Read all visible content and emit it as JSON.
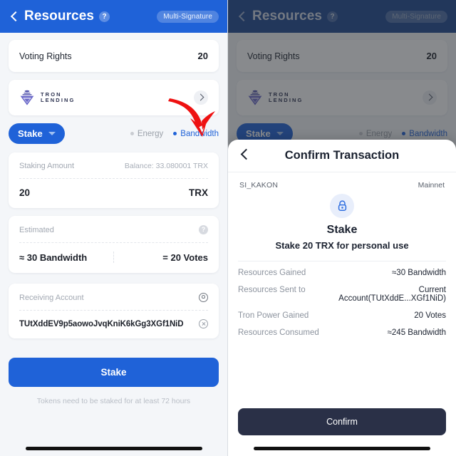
{
  "header": {
    "back_icon": "chevron-left-icon",
    "title": "Resources",
    "help_label": "?",
    "multisig_badge": "Multi-Signature"
  },
  "voting": {
    "label": "Voting Rights",
    "value": "20"
  },
  "lending": {
    "logo_line1": "TRON",
    "logo_line2": "LENDING",
    "chevron_icon": "chevron-right-icon"
  },
  "selector": {
    "stake_label": "Stake",
    "caret_icon": "caret-down-icon",
    "options": [
      {
        "label": "Energy",
        "active": false
      },
      {
        "label": "Bandwidth",
        "active": true
      }
    ]
  },
  "staking": {
    "amount_label": "Staking Amount",
    "balance_label": "Balance: 33.080001 TRX",
    "amount_value": "20",
    "unit": "TRX",
    "estimated_label": "Estimated",
    "help_icon": "question-mark-icon",
    "estimated_left": "≈ 30 Bandwidth",
    "estimated_right": "= 20 Votes"
  },
  "receiving": {
    "label": "Receiving Account",
    "address_book_icon": "address-book-icon",
    "address": "TUtXddEV9p5aowoJvqKniK6kGg3XGf1NiD",
    "clear_icon": "clear-circle-icon"
  },
  "actions": {
    "stake_button": "Stake",
    "footnote": "Tokens need to be staked for at least 72 hours"
  },
  "sheet": {
    "back_icon": "chevron-left-icon",
    "title": "Confirm Transaction",
    "account_name": "SI_KAKON",
    "network": "Mainnet",
    "lock_icon": "lock-icon",
    "tx_type": "Stake",
    "tx_description": "Stake 20 TRX for personal use",
    "details": [
      {
        "key": "Resources Gained",
        "value": "≈30 Bandwidth"
      },
      {
        "key": "Resources Sent to",
        "value": "Current Account(TUtXddE...XGf1NiD)"
      },
      {
        "key": "Tron Power Gained",
        "value": "20 Votes"
      },
      {
        "key": "Resources Consumed",
        "value": "≈245 Bandwidth"
      }
    ],
    "confirm_button": "Confirm"
  },
  "colors": {
    "brand_blue": "#1f62d8",
    "header_dim_blue": "#1d4790",
    "confirm_dark": "#2a3047",
    "annotation_red": "#ee1111"
  }
}
